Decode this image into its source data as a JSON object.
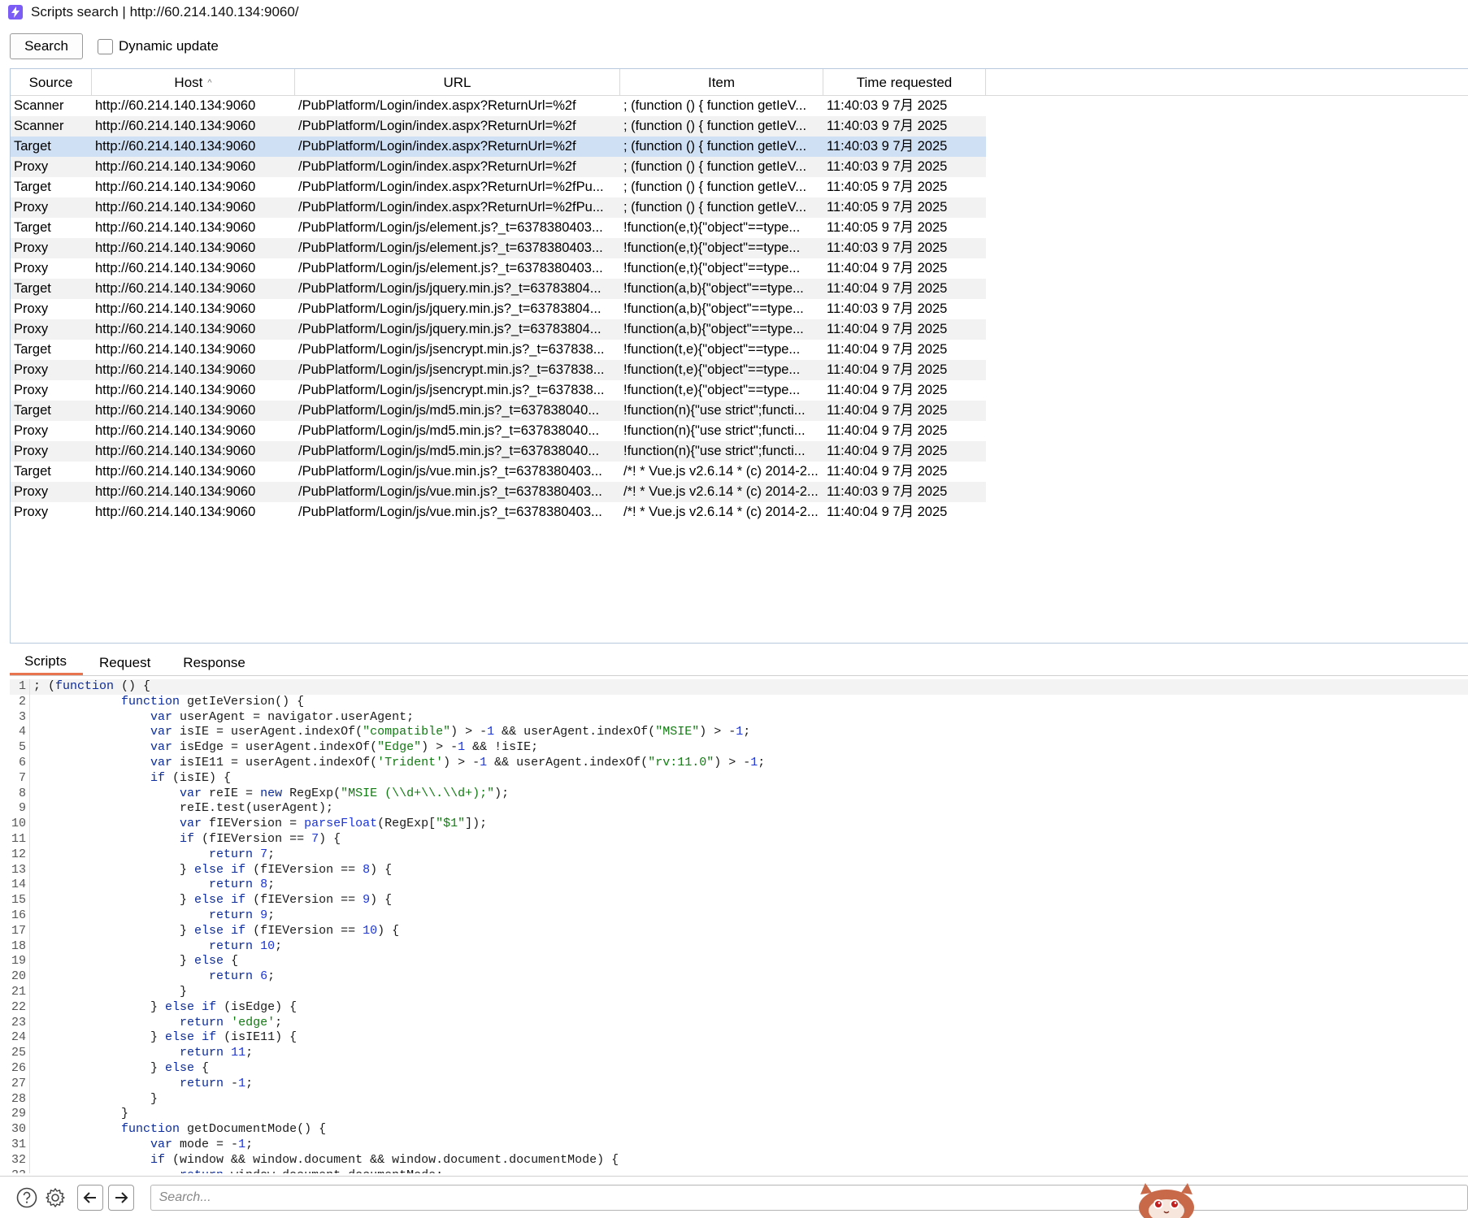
{
  "window": {
    "title": "Scripts search | http://60.214.140.134:9060/"
  },
  "toolbar": {
    "search_label": "Search",
    "dynamic_update_label": "Dynamic update"
  },
  "table": {
    "columns": [
      "Source",
      "Host",
      "URL",
      "Item",
      "Time requested"
    ],
    "sorted_column": "Host",
    "rows": [
      [
        "Scanner",
        "http://60.214.140.134:9060",
        "/PubPlatform/Login/index.aspx?ReturnUrl=%2f",
        "; (function () { function getIeV...",
        "11:40:03 9 7月 2025"
      ],
      [
        "Scanner",
        "http://60.214.140.134:9060",
        "/PubPlatform/Login/index.aspx?ReturnUrl=%2f",
        "; (function () { function getIeV...",
        "11:40:03 9 7月 2025"
      ],
      [
        "Target",
        "http://60.214.140.134:9060",
        "/PubPlatform/Login/index.aspx?ReturnUrl=%2f",
        "; (function () { function getIeV...",
        "11:40:03 9 7月 2025"
      ],
      [
        "Proxy",
        "http://60.214.140.134:9060",
        "/PubPlatform/Login/index.aspx?ReturnUrl=%2f",
        "; (function () { function getIeV...",
        "11:40:03 9 7月 2025"
      ],
      [
        "Target",
        "http://60.214.140.134:9060",
        "/PubPlatform/Login/index.aspx?ReturnUrl=%2fPu...",
        "; (function () { function getIeV...",
        "11:40:05 9 7月 2025"
      ],
      [
        "Proxy",
        "http://60.214.140.134:9060",
        "/PubPlatform/Login/index.aspx?ReturnUrl=%2fPu...",
        "; (function () { function getIeV...",
        "11:40:05 9 7月 2025"
      ],
      [
        "Target",
        "http://60.214.140.134:9060",
        "/PubPlatform/Login/js/element.js?_t=6378380403...",
        "!function(e,t){\"object\"==type...",
        "11:40:05 9 7月 2025"
      ],
      [
        "Proxy",
        "http://60.214.140.134:9060",
        "/PubPlatform/Login/js/element.js?_t=6378380403...",
        "!function(e,t){\"object\"==type...",
        "11:40:03 9 7月 2025"
      ],
      [
        "Proxy",
        "http://60.214.140.134:9060",
        "/PubPlatform/Login/js/element.js?_t=6378380403...",
        "!function(e,t){\"object\"==type...",
        "11:40:04 9 7月 2025"
      ],
      [
        "Target",
        "http://60.214.140.134:9060",
        "/PubPlatform/Login/js/jquery.min.js?_t=63783804...",
        "!function(a,b){\"object\"==type...",
        "11:40:04 9 7月 2025"
      ],
      [
        "Proxy",
        "http://60.214.140.134:9060",
        "/PubPlatform/Login/js/jquery.min.js?_t=63783804...",
        "!function(a,b){\"object\"==type...",
        "11:40:03 9 7月 2025"
      ],
      [
        "Proxy",
        "http://60.214.140.134:9060",
        "/PubPlatform/Login/js/jquery.min.js?_t=63783804...",
        "!function(a,b){\"object\"==type...",
        "11:40:04 9 7月 2025"
      ],
      [
        "Target",
        "http://60.214.140.134:9060",
        "/PubPlatform/Login/js/jsencrypt.min.js?_t=637838...",
        "!function(t,e){\"object\"==type...",
        "11:40:04 9 7月 2025"
      ],
      [
        "Proxy",
        "http://60.214.140.134:9060",
        "/PubPlatform/Login/js/jsencrypt.min.js?_t=637838...",
        "!function(t,e){\"object\"==type...",
        "11:40:04 9 7月 2025"
      ],
      [
        "Proxy",
        "http://60.214.140.134:9060",
        "/PubPlatform/Login/js/jsencrypt.min.js?_t=637838...",
        "!function(t,e){\"object\"==type...",
        "11:40:04 9 7月 2025"
      ],
      [
        "Target",
        "http://60.214.140.134:9060",
        "/PubPlatform/Login/js/md5.min.js?_t=637838040...",
        "!function(n){\"use strict\";functi...",
        "11:40:04 9 7月 2025"
      ],
      [
        "Proxy",
        "http://60.214.140.134:9060",
        "/PubPlatform/Login/js/md5.min.js?_t=637838040...",
        "!function(n){\"use strict\";functi...",
        "11:40:04 9 7月 2025"
      ],
      [
        "Proxy",
        "http://60.214.140.134:9060",
        "/PubPlatform/Login/js/md5.min.js?_t=637838040...",
        "!function(n){\"use strict\";functi...",
        "11:40:04 9 7月 2025"
      ],
      [
        "Target",
        "http://60.214.140.134:9060",
        "/PubPlatform/Login/js/vue.min.js?_t=6378380403...",
        "/*! * Vue.js v2.6.14 * (c) 2014-2...",
        "11:40:04 9 7月 2025"
      ],
      [
        "Proxy",
        "http://60.214.140.134:9060",
        "/PubPlatform/Login/js/vue.min.js?_t=6378380403...",
        "/*! * Vue.js v2.6.14 * (c) 2014-2...",
        "11:40:03 9 7月 2025"
      ],
      [
        "Proxy",
        "http://60.214.140.134:9060",
        "/PubPlatform/Login/js/vue.min.js?_t=6378380403...",
        "/*! * Vue.js v2.6.14 * (c) 2014-2...",
        "11:40:04 9 7月 2025"
      ]
    ],
    "selected_row_index": 2
  },
  "tabs": {
    "items": [
      "Scripts",
      "Request",
      "Response"
    ],
    "active": "Scripts"
  },
  "editor": {
    "current_line": 1,
    "lines": [
      "; (function () {",
      "            function getIeVersion() {",
      "                var userAgent = navigator.userAgent;",
      "                var isIE = userAgent.indexOf(\"compatible\") > -1 && userAgent.indexOf(\"MSIE\") > -1;",
      "                var isEdge = userAgent.indexOf(\"Edge\") > -1 && !isIE;",
      "                var isIE11 = userAgent.indexOf('Trident') > -1 && userAgent.indexOf(\"rv:11.0\") > -1;",
      "                if (isIE) {",
      "                    var reIE = new RegExp(\"MSIE (\\\\d+\\\\.\\\\d+);\");",
      "                    reIE.test(userAgent);",
      "                    var fIEVersion = parseFloat(RegExp[\"$1\"]);",
      "                    if (fIEVersion == 7) {",
      "                        return 7;",
      "                    } else if (fIEVersion == 8) {",
      "                        return 8;",
      "                    } else if (fIEVersion == 9) {",
      "                        return 9;",
      "                    } else if (fIEVersion == 10) {",
      "                        return 10;",
      "                    } else {",
      "                        return 6;",
      "                    }",
      "                } else if (isEdge) {",
      "                    return 'edge';",
      "                } else if (isIE11) {",
      "                    return 11;",
      "                } else {",
      "                    return -1;",
      "                }",
      "            }",
      "            function getDocumentMode() {",
      "                var mode = -1;",
      "                if (window && window.document && window.document.documentMode) {",
      "                    return window.document.documentMode;"
    ]
  },
  "bottom": {
    "search_placeholder": "Search..."
  },
  "icons": {
    "app": "scripts-search-app-icon",
    "help": "help-icon",
    "settings": "gear-icon",
    "back": "arrow-left-icon",
    "forward": "arrow-right-icon",
    "sort": "sort-ascending-icon"
  },
  "colors": {
    "accent": "#e8744f",
    "selection": "#cfdff4",
    "app_icon": "#7b5cf5",
    "keyword": "#0b2b9a",
    "string": "#127a12",
    "number": "#1a34d6"
  }
}
